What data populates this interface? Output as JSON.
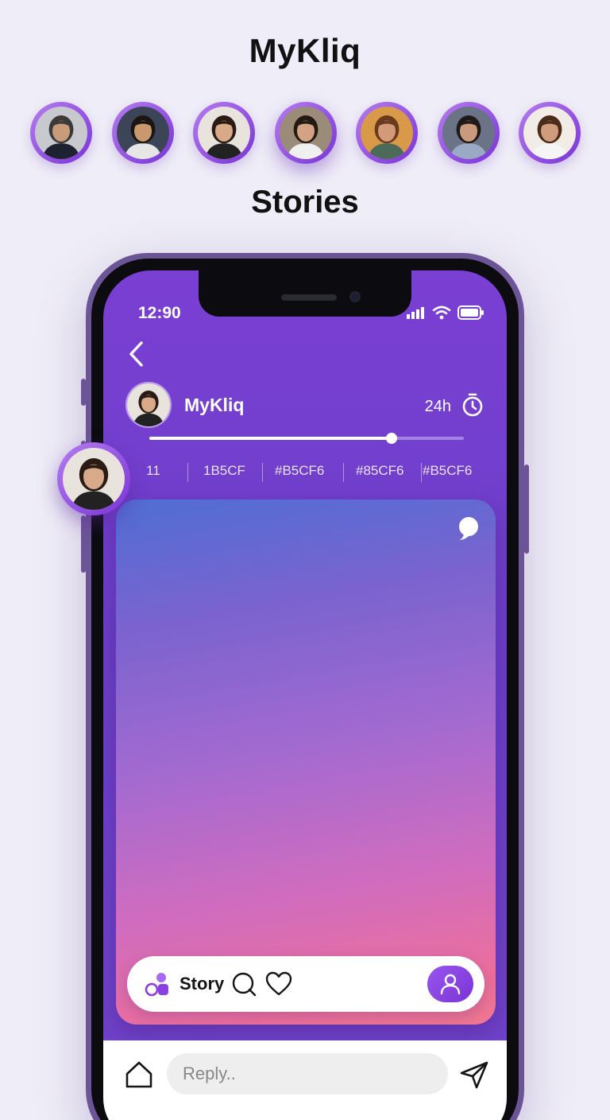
{
  "app": {
    "title": "MyKliq"
  },
  "stories": {
    "section_title": "Stories",
    "avatars": [
      {
        "icon": "avatar-photo",
        "bg": "#c7c9cf",
        "hair": "#3a3a3a",
        "skin": "#c89b7b",
        "shirt": "#1e2230",
        "active": false
      },
      {
        "icon": "avatar-photo",
        "bg": "#3c4457",
        "hair": "#1c1612",
        "skin": "#c9986f",
        "shirt": "#e6e6e6",
        "active": false
      },
      {
        "icon": "avatar-photo",
        "bg": "#e8e3dc",
        "hair": "#2a1c14",
        "skin": "#d8aa8a",
        "shirt": "#222222",
        "active": false
      },
      {
        "icon": "avatar-photo",
        "bg": "#9a8c78",
        "hair": "#241a14",
        "skin": "#d4a384",
        "shirt": "#f0f0f0",
        "active": true
      },
      {
        "icon": "avatar-photo",
        "bg": "#d89a48",
        "hair": "#6a3a1e",
        "skin": "#d29a78",
        "shirt": "#4c6a5a",
        "active": false
      },
      {
        "icon": "avatar-photo",
        "bg": "#6b7486",
        "hair": "#1f1a17",
        "skin": "#c99b7c",
        "shirt": "#9aa9c4",
        "active": false
      },
      {
        "icon": "avatar-photo",
        "bg": "#f1ece6",
        "hair": "#4a2a18",
        "skin": "#cf9c7e",
        "shirt": "#f5f5f5",
        "active": false
      }
    ]
  },
  "status_bar": {
    "time": "12:90"
  },
  "story_header": {
    "back_icon": "chevron-left-icon",
    "name": "MyKliq",
    "duration": "24h",
    "timer_icon": "timer-icon",
    "progress": 0.77,
    "progress_segment": 0.23
  },
  "tags": [
    "11",
    "1B5CF",
    "#B5CF6",
    "#85CF6",
    "#B5CF6"
  ],
  "story_card": {
    "bubble_icon": "chat-bubble-icon",
    "actions": {
      "shapes_icon": "shapes-icon",
      "label": "Story",
      "comment_icon": "comment-icon",
      "like_icon": "heart-icon",
      "profile_icon": "profile-icon"
    }
  },
  "reply_bar": {
    "home_icon": "home-icon",
    "placeholder": "Reply..",
    "send_icon": "send-icon"
  },
  "colors": {
    "accent": "#7a34d6",
    "screen_bg": "#6c3fc9",
    "page_bg": "#efedf7"
  }
}
